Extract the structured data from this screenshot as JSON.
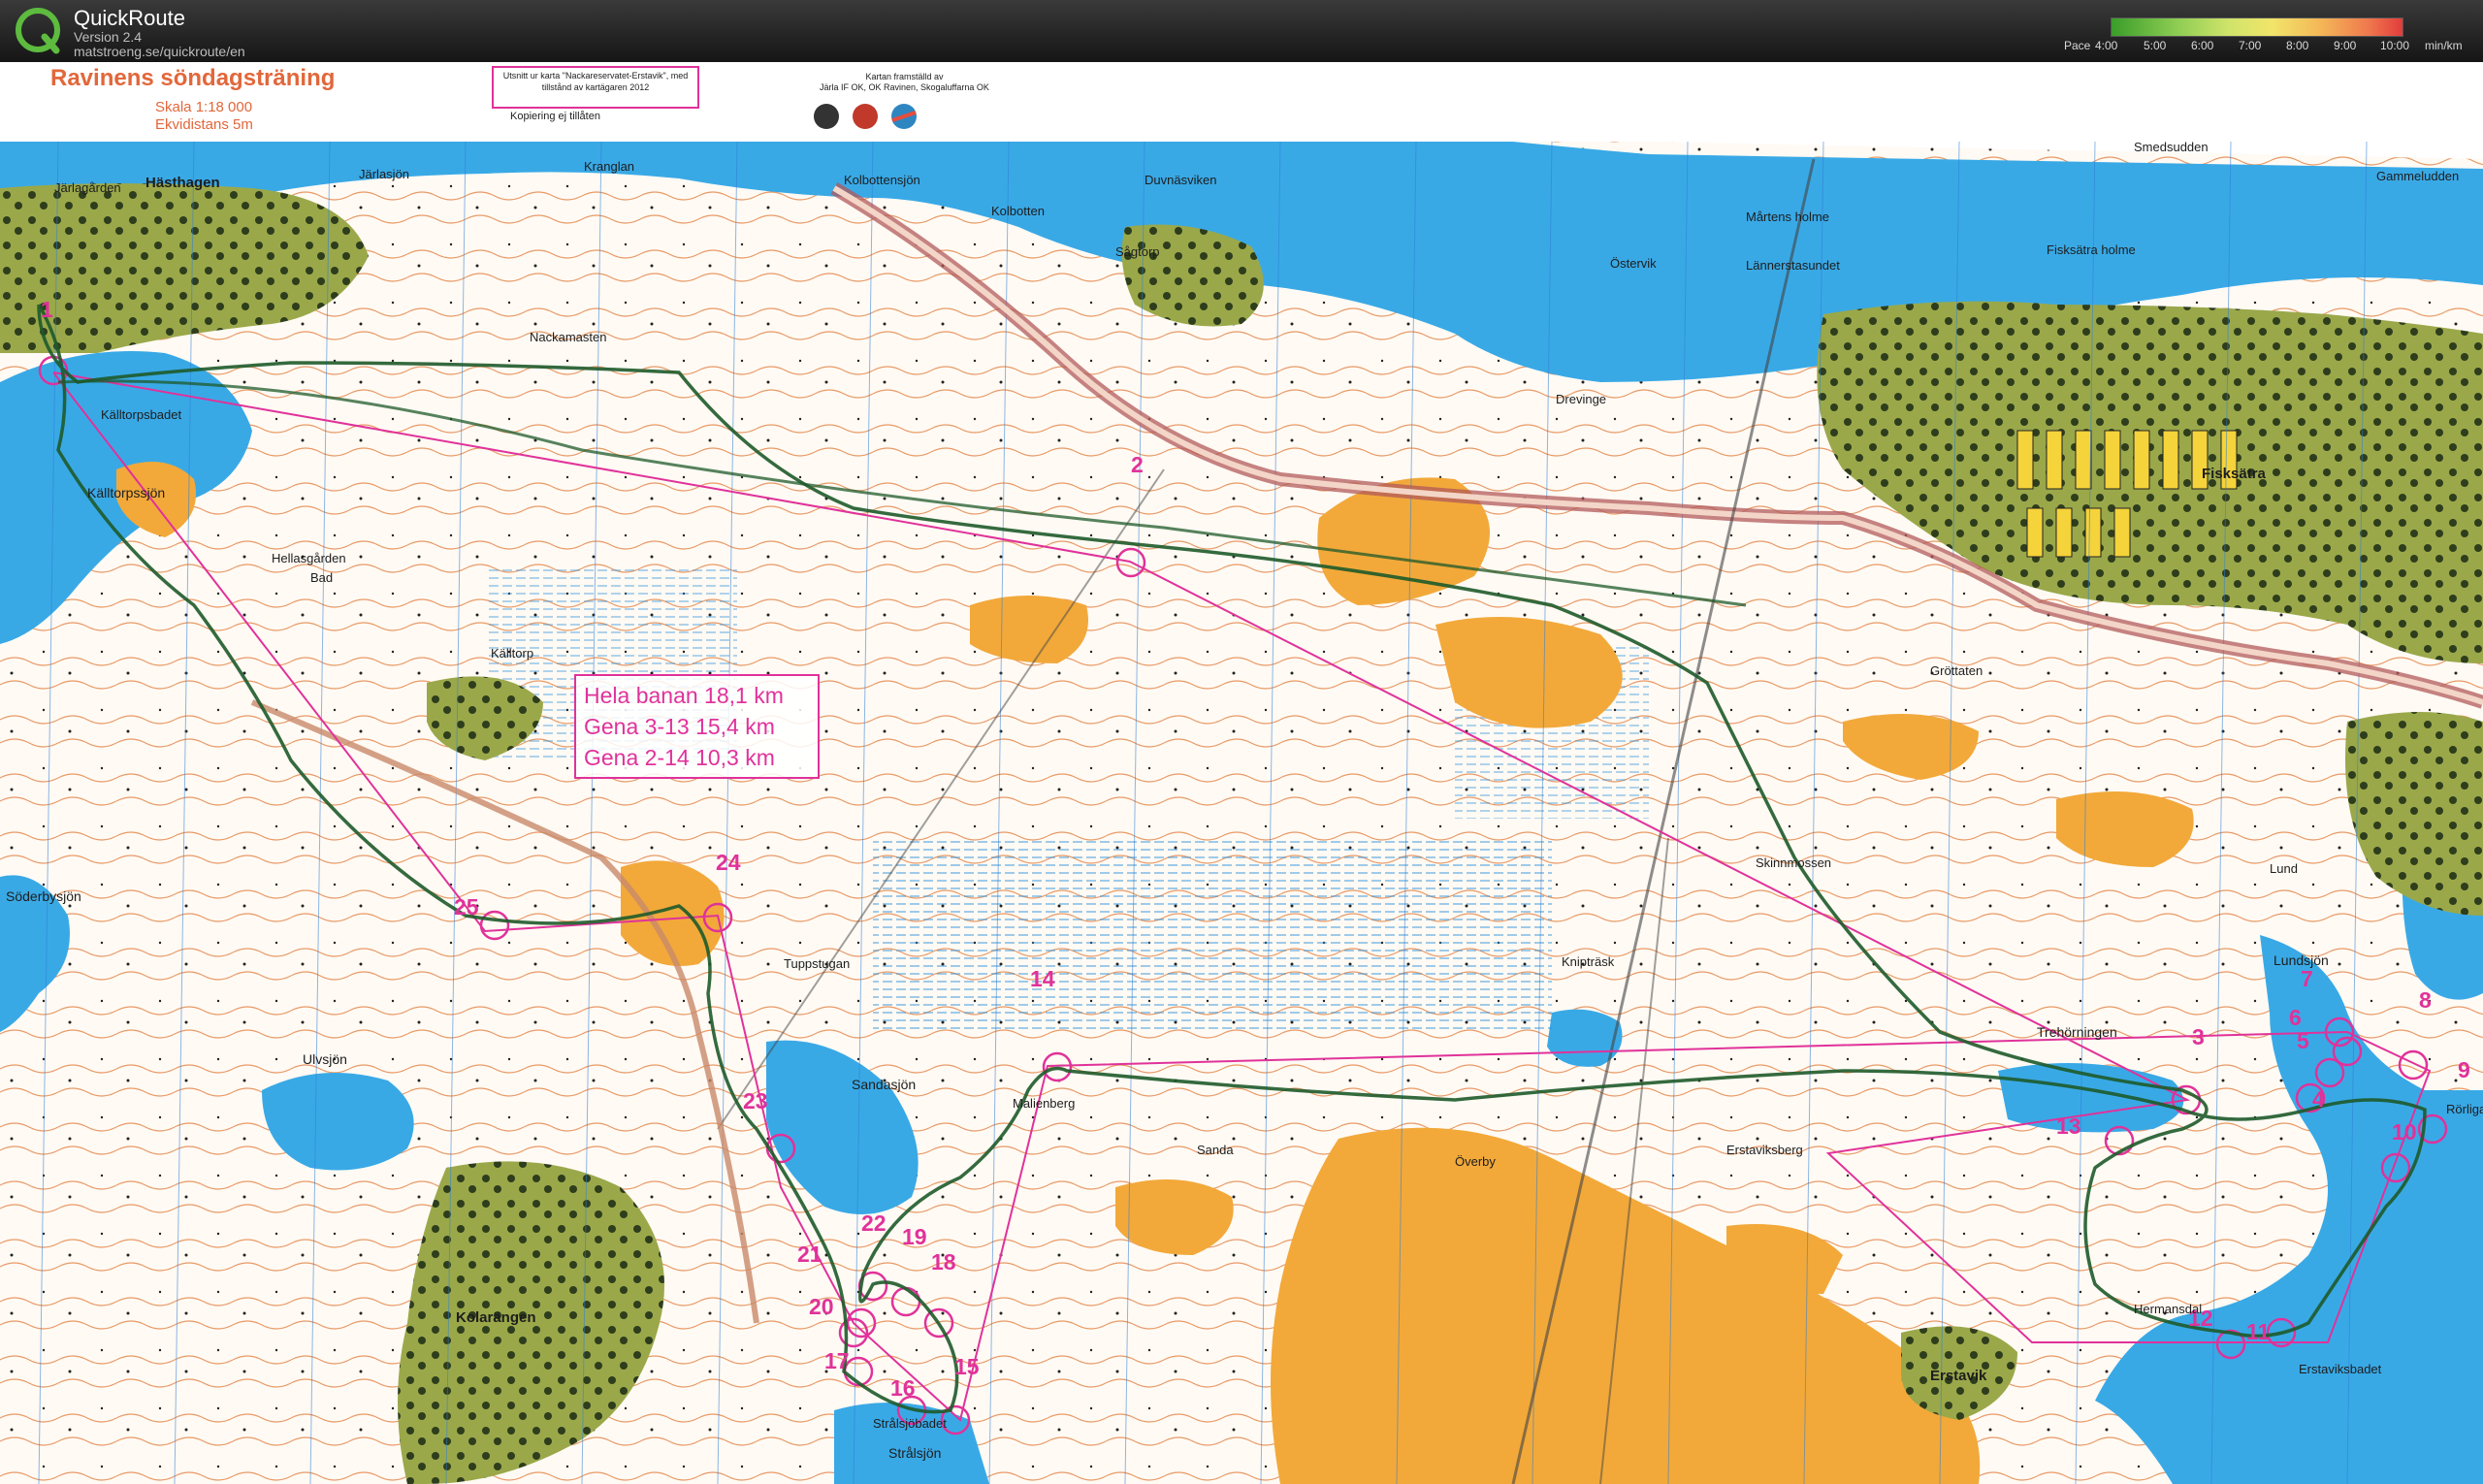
{
  "app": {
    "name": "QuickRoute",
    "version": "Version 2.4",
    "url": "matstroeng.se/quickroute/en"
  },
  "pace_legend": {
    "label": "Pace",
    "ticks": [
      "4:00",
      "5:00",
      "6:00",
      "7:00",
      "8:00",
      "9:00",
      "10:00"
    ],
    "unit": "min/km",
    "colors": [
      "#3a9d2a",
      "#8ccc52",
      "#cfe36a",
      "#f1e56a",
      "#f4b657",
      "#ef7a4e",
      "#e23c3c"
    ]
  },
  "map": {
    "title": "Ravinens söndagsträning",
    "scale": "Skala 1:18 000",
    "contour": "Ekvidistans 5m",
    "permission": "Utsnitt ur karta \"Nackareservatet-Erstavik\", med tillstånd av kartägaren 2012",
    "credits": "Kartan framställd av\nJärla IF OK, OK Ravinen, Skogaluffarna OK",
    "copy_note": "Kopiering ej tillåten",
    "info_box": [
      "Hela banan 18,1 km",
      "Gena 3-13 15,4 km",
      "Gena 2-14 10,3 km"
    ],
    "colors": {
      "water": "#39a9e6",
      "forest": "#ffffff",
      "open_land": "#f2a93a",
      "urban": "#8ea23c",
      "contour": "#d9743a",
      "course": "#e0329a",
      "route": "#1e5a2a"
    }
  },
  "controls": [
    {
      "n": "1"
    },
    {
      "n": "2"
    },
    {
      "n": "3"
    },
    {
      "n": "4"
    },
    {
      "n": "5"
    },
    {
      "n": "6"
    },
    {
      "n": "7"
    },
    {
      "n": "8"
    },
    {
      "n": "9"
    },
    {
      "n": "10"
    },
    {
      "n": "11"
    },
    {
      "n": "12"
    },
    {
      "n": "13"
    },
    {
      "n": "14"
    },
    {
      "n": "15"
    },
    {
      "n": "16"
    },
    {
      "n": "17"
    },
    {
      "n": "18"
    },
    {
      "n": "19"
    },
    {
      "n": "20"
    },
    {
      "n": "21"
    },
    {
      "n": "22"
    },
    {
      "n": "23"
    },
    {
      "n": "24"
    },
    {
      "n": "25"
    }
  ],
  "places": [
    "Hästhagen",
    "Järlasjön",
    "Kranglan",
    "Kolbottensjön",
    "Kolbotten",
    "Duvnäsviken",
    "Järlagården",
    "Nackamasten",
    "Sågtorp",
    "Källtorpsbadet",
    "Källtorpssjön",
    "Hellasgården",
    "Bad",
    "Källtorp",
    "Drevinge",
    "Östervik",
    "Mårtens holme",
    "Smedsudden",
    "Gammeludden",
    "Lännerstasundet",
    "Fisksätra holme",
    "Fisksätra",
    "Gröttaten",
    "Skinnmossen",
    "Knipträsk",
    "Söderbysjön",
    "Ulvsjön",
    "Tuppstugan",
    "Sandasjön",
    "Malienberg",
    "Sanda",
    "Överby",
    "Erstaviksberg",
    "Trehörningen",
    "Lund",
    "Lundsjön",
    "Rörliga ser",
    "Hermansdal",
    "Erstavik",
    "Erstaviksbadet",
    "Kolarängen",
    "Strålsjöbadet",
    "Strålsjön"
  ]
}
